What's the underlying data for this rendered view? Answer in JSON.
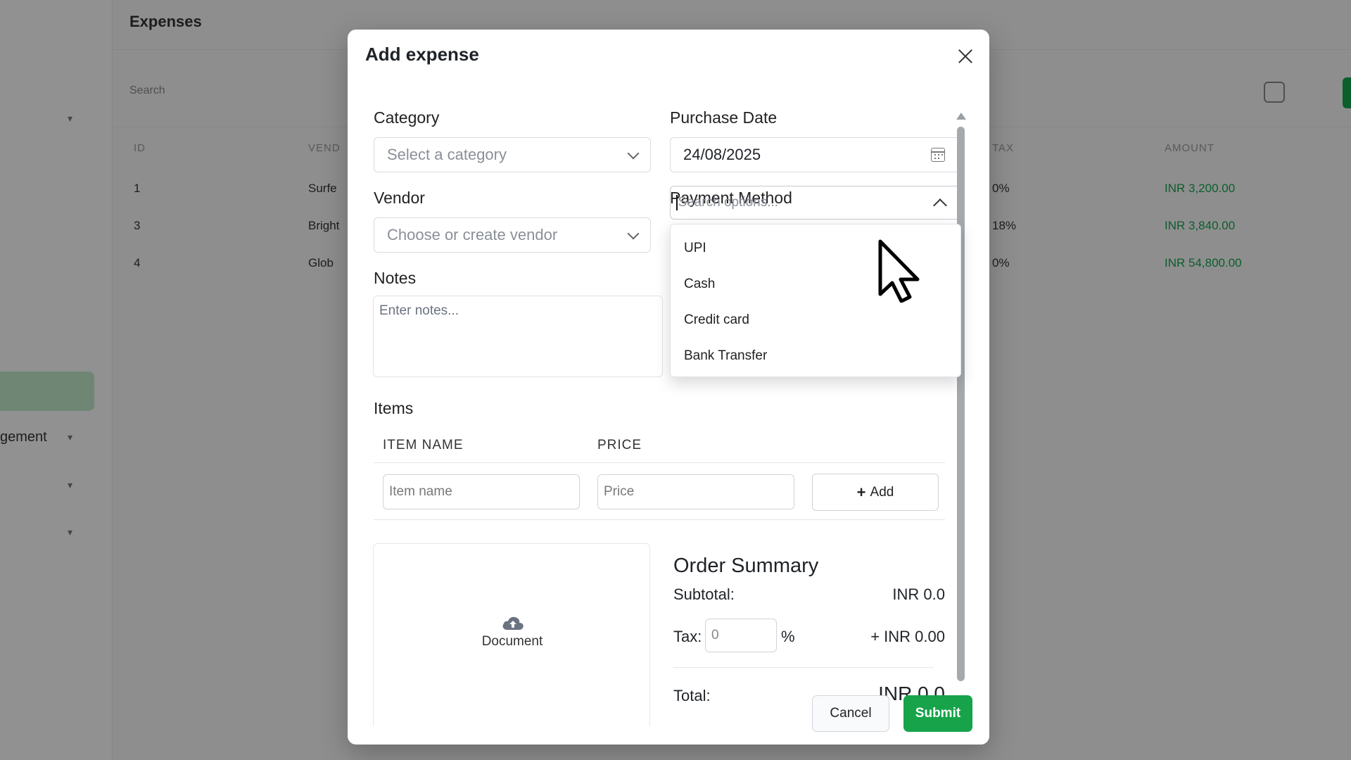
{
  "background": {
    "page_title": "Expenses",
    "search_placeholder": "Search",
    "sidebar_partial_label": "gement",
    "table_headers": [
      "ID",
      "VEND",
      "TAX",
      "AMOUNT"
    ],
    "rows": [
      {
        "id": "1",
        "vendor": "Surfe",
        "tax": "0%",
        "amount": "INR 3,200.00"
      },
      {
        "id": "3",
        "vendor": "Bright",
        "tax": "18%",
        "amount": "INR 3,840.00"
      },
      {
        "id": "4",
        "vendor": "Glob",
        "tax": "0%",
        "amount": "INR 54,800.00"
      }
    ]
  },
  "modal": {
    "title": "Add expense",
    "category": {
      "label": "Category",
      "placeholder": "Select a category"
    },
    "purchase_date": {
      "label": "Purchase Date",
      "value": "24/08/2025"
    },
    "vendor": {
      "label": "Vendor",
      "placeholder": "Choose or create vendor"
    },
    "payment_method": {
      "label": "Payment Method",
      "search_placeholder": "Search options...",
      "options": [
        "UPI",
        "Cash",
        "Credit card",
        "Bank Transfer"
      ]
    },
    "notes": {
      "label": "Notes",
      "placeholder": "Enter notes..."
    },
    "items": {
      "label": "Items",
      "col_name": "ITEM NAME",
      "col_price": "PRICE",
      "name_placeholder": "Item name",
      "price_placeholder": "Price",
      "add_label": "Add"
    },
    "upload": {
      "label": "Document"
    },
    "summary": {
      "title": "Order Summary",
      "subtotal_label": "Subtotal:",
      "subtotal_value": "INR 0.0",
      "tax_label": "Tax:",
      "tax_placeholder": "0",
      "tax_unit": "%",
      "tax_value": "+ INR 0.00",
      "total_label": "Total:",
      "total_value": "INR 0.0"
    },
    "cancel_label": "Cancel",
    "submit_label": "Submit"
  },
  "colors": {
    "accent": "#16a34a",
    "overlay": "rgba(0,0,0,0.42)"
  },
  "icons": [
    "close-icon",
    "chevron-down-icon",
    "calendar-icon",
    "chevron-up-icon",
    "plus-icon",
    "cloud-upload-icon",
    "scroll-up-icon",
    "scroll-down-icon",
    "mouse-pointer-icon"
  ]
}
